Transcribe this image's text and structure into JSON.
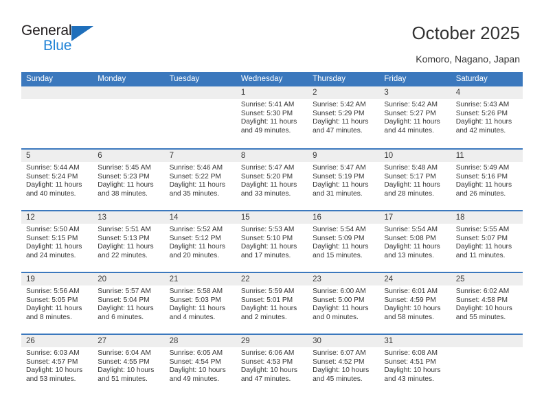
{
  "brand": {
    "name_top": "General",
    "name_bottom": "Blue",
    "triangle_color": "#1f6fbb",
    "blue_text_color": "#2183d6"
  },
  "header": {
    "title": "October 2025",
    "subtitle": "Komoro, Nagano, Japan"
  },
  "theme": {
    "header_blue": "#3b78bd",
    "day_band_gray": "#eeeeee",
    "text_color": "#333333"
  },
  "weekdays": [
    "Sunday",
    "Monday",
    "Tuesday",
    "Wednesday",
    "Thursday",
    "Friday",
    "Saturday"
  ],
  "weeks": [
    [
      {
        "day": "",
        "lines": []
      },
      {
        "day": "",
        "lines": []
      },
      {
        "day": "",
        "lines": []
      },
      {
        "day": "1",
        "lines": [
          "Sunrise: 5:41 AM",
          "Sunset: 5:30 PM",
          "Daylight: 11 hours",
          "and 49 minutes."
        ]
      },
      {
        "day": "2",
        "lines": [
          "Sunrise: 5:42 AM",
          "Sunset: 5:29 PM",
          "Daylight: 11 hours",
          "and 47 minutes."
        ]
      },
      {
        "day": "3",
        "lines": [
          "Sunrise: 5:42 AM",
          "Sunset: 5:27 PM",
          "Daylight: 11 hours",
          "and 44 minutes."
        ]
      },
      {
        "day": "4",
        "lines": [
          "Sunrise: 5:43 AM",
          "Sunset: 5:26 PM",
          "Daylight: 11 hours",
          "and 42 minutes."
        ]
      }
    ],
    [
      {
        "day": "5",
        "lines": [
          "Sunrise: 5:44 AM",
          "Sunset: 5:24 PM",
          "Daylight: 11 hours",
          "and 40 minutes."
        ]
      },
      {
        "day": "6",
        "lines": [
          "Sunrise: 5:45 AM",
          "Sunset: 5:23 PM",
          "Daylight: 11 hours",
          "and 38 minutes."
        ]
      },
      {
        "day": "7",
        "lines": [
          "Sunrise: 5:46 AM",
          "Sunset: 5:22 PM",
          "Daylight: 11 hours",
          "and 35 minutes."
        ]
      },
      {
        "day": "8",
        "lines": [
          "Sunrise: 5:47 AM",
          "Sunset: 5:20 PM",
          "Daylight: 11 hours",
          "and 33 minutes."
        ]
      },
      {
        "day": "9",
        "lines": [
          "Sunrise: 5:47 AM",
          "Sunset: 5:19 PM",
          "Daylight: 11 hours",
          "and 31 minutes."
        ]
      },
      {
        "day": "10",
        "lines": [
          "Sunrise: 5:48 AM",
          "Sunset: 5:17 PM",
          "Daylight: 11 hours",
          "and 28 minutes."
        ]
      },
      {
        "day": "11",
        "lines": [
          "Sunrise: 5:49 AM",
          "Sunset: 5:16 PM",
          "Daylight: 11 hours",
          "and 26 minutes."
        ]
      }
    ],
    [
      {
        "day": "12",
        "lines": [
          "Sunrise: 5:50 AM",
          "Sunset: 5:15 PM",
          "Daylight: 11 hours",
          "and 24 minutes."
        ]
      },
      {
        "day": "13",
        "lines": [
          "Sunrise: 5:51 AM",
          "Sunset: 5:13 PM",
          "Daylight: 11 hours",
          "and 22 minutes."
        ]
      },
      {
        "day": "14",
        "lines": [
          "Sunrise: 5:52 AM",
          "Sunset: 5:12 PM",
          "Daylight: 11 hours",
          "and 20 minutes."
        ]
      },
      {
        "day": "15",
        "lines": [
          "Sunrise: 5:53 AM",
          "Sunset: 5:10 PM",
          "Daylight: 11 hours",
          "and 17 minutes."
        ]
      },
      {
        "day": "16",
        "lines": [
          "Sunrise: 5:54 AM",
          "Sunset: 5:09 PM",
          "Daylight: 11 hours",
          "and 15 minutes."
        ]
      },
      {
        "day": "17",
        "lines": [
          "Sunrise: 5:54 AM",
          "Sunset: 5:08 PM",
          "Daylight: 11 hours",
          "and 13 minutes."
        ]
      },
      {
        "day": "18",
        "lines": [
          "Sunrise: 5:55 AM",
          "Sunset: 5:07 PM",
          "Daylight: 11 hours",
          "and 11 minutes."
        ]
      }
    ],
    [
      {
        "day": "19",
        "lines": [
          "Sunrise: 5:56 AM",
          "Sunset: 5:05 PM",
          "Daylight: 11 hours",
          "and 8 minutes."
        ]
      },
      {
        "day": "20",
        "lines": [
          "Sunrise: 5:57 AM",
          "Sunset: 5:04 PM",
          "Daylight: 11 hours",
          "and 6 minutes."
        ]
      },
      {
        "day": "21",
        "lines": [
          "Sunrise: 5:58 AM",
          "Sunset: 5:03 PM",
          "Daylight: 11 hours",
          "and 4 minutes."
        ]
      },
      {
        "day": "22",
        "lines": [
          "Sunrise: 5:59 AM",
          "Sunset: 5:01 PM",
          "Daylight: 11 hours",
          "and 2 minutes."
        ]
      },
      {
        "day": "23",
        "lines": [
          "Sunrise: 6:00 AM",
          "Sunset: 5:00 PM",
          "Daylight: 11 hours",
          "and 0 minutes."
        ]
      },
      {
        "day": "24",
        "lines": [
          "Sunrise: 6:01 AM",
          "Sunset: 4:59 PM",
          "Daylight: 10 hours",
          "and 58 minutes."
        ]
      },
      {
        "day": "25",
        "lines": [
          "Sunrise: 6:02 AM",
          "Sunset: 4:58 PM",
          "Daylight: 10 hours",
          "and 55 minutes."
        ]
      }
    ],
    [
      {
        "day": "26",
        "lines": [
          "Sunrise: 6:03 AM",
          "Sunset: 4:57 PM",
          "Daylight: 10 hours",
          "and 53 minutes."
        ]
      },
      {
        "day": "27",
        "lines": [
          "Sunrise: 6:04 AM",
          "Sunset: 4:55 PM",
          "Daylight: 10 hours",
          "and 51 minutes."
        ]
      },
      {
        "day": "28",
        "lines": [
          "Sunrise: 6:05 AM",
          "Sunset: 4:54 PM",
          "Daylight: 10 hours",
          "and 49 minutes."
        ]
      },
      {
        "day": "29",
        "lines": [
          "Sunrise: 6:06 AM",
          "Sunset: 4:53 PM",
          "Daylight: 10 hours",
          "and 47 minutes."
        ]
      },
      {
        "day": "30",
        "lines": [
          "Sunrise: 6:07 AM",
          "Sunset: 4:52 PM",
          "Daylight: 10 hours",
          "and 45 minutes."
        ]
      },
      {
        "day": "31",
        "lines": [
          "Sunrise: 6:08 AM",
          "Sunset: 4:51 PM",
          "Daylight: 10 hours",
          "and 43 minutes."
        ]
      },
      {
        "day": "",
        "lines": []
      }
    ]
  ]
}
